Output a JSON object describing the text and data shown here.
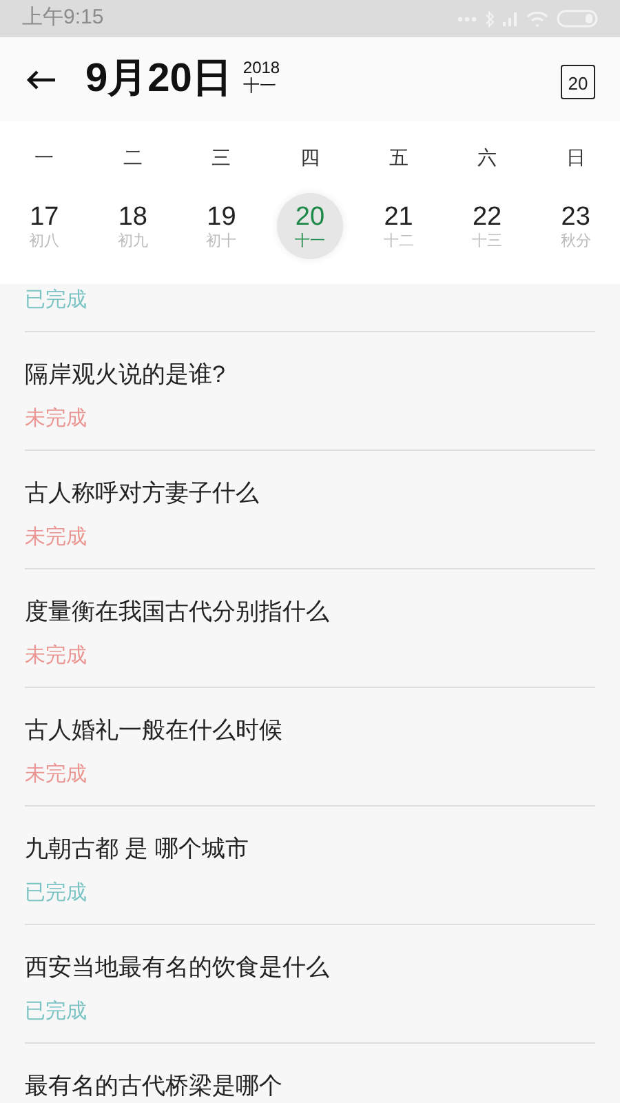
{
  "status_bar": {
    "time": "上午9:15"
  },
  "header": {
    "date": "9月20日",
    "year": "2018",
    "lunar": "十一",
    "calendar_button": "20"
  },
  "weekdays": [
    "一",
    "二",
    "三",
    "四",
    "五",
    "六",
    "日"
  ],
  "days": [
    {
      "day": "17",
      "lunar": "初八",
      "selected": false
    },
    {
      "day": "18",
      "lunar": "初九",
      "selected": false
    },
    {
      "day": "19",
      "lunar": "初十",
      "selected": false
    },
    {
      "day": "20",
      "lunar": "十一",
      "selected": true
    },
    {
      "day": "21",
      "lunar": "十二",
      "selected": false
    },
    {
      "day": "22",
      "lunar": "十三",
      "selected": false
    },
    {
      "day": "23",
      "lunar": "秋分",
      "selected": false
    }
  ],
  "items": [
    {
      "status": "已完成",
      "completed": true
    },
    {
      "question": "隔岸观火说的是谁?",
      "status": "未完成",
      "completed": false
    },
    {
      "question": "古人称呼对方妻子什么",
      "status": "未完成",
      "completed": false
    },
    {
      "question": "度量衡在我国古代分别指什么",
      "status": "未完成",
      "completed": false
    },
    {
      "question": "古人婚礼一般在什么时候",
      "status": "未完成",
      "completed": false
    },
    {
      "question": "九朝古都 是 哪个城市",
      "status": "已完成",
      "completed": true
    },
    {
      "question": "西安当地最有名的饮食是什么",
      "status": "已完成",
      "completed": true
    },
    {
      "question": "最有名的古代桥梁是哪个"
    }
  ]
}
